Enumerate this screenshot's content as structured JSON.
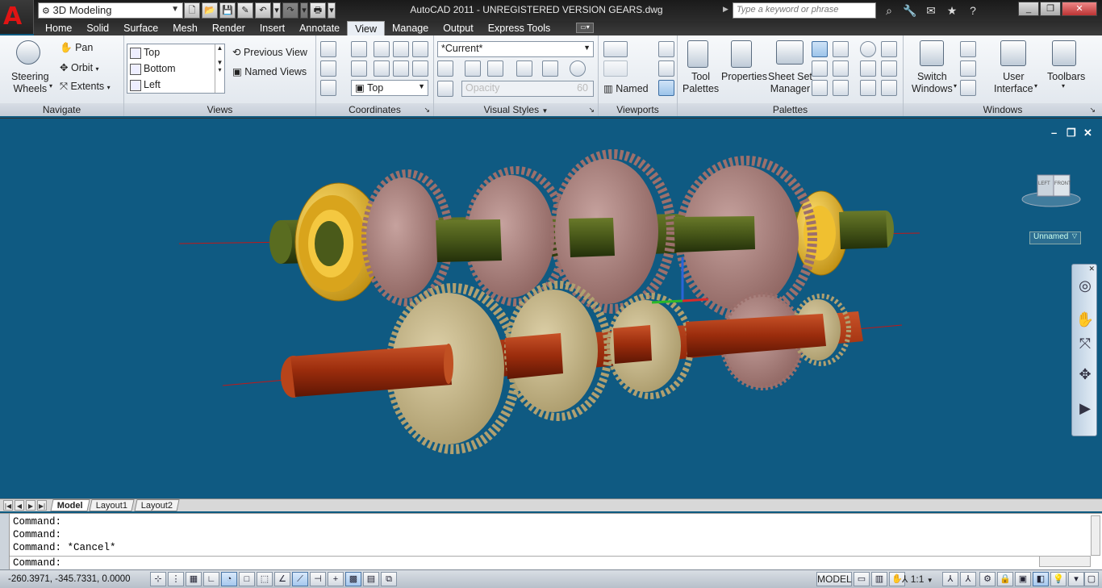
{
  "title_bar": {
    "workspace": "3D Modeling",
    "title": "AutoCAD 2011 - UNREGISTERED VERSION    GEARS.dwg",
    "search_placeholder": "Type a keyword or phrase"
  },
  "ribbon_tabs": [
    "Home",
    "Solid",
    "Surface",
    "Mesh",
    "Render",
    "Insert",
    "Annotate",
    "View",
    "Manage",
    "Output",
    "Express Tools"
  ],
  "active_tab": "View",
  "navigate": {
    "title": "Navigate",
    "steering_wheels": "Steering\nWheels",
    "pan": "Pan",
    "orbit": "Orbit",
    "extents": "Extents"
  },
  "views": {
    "title": "Views",
    "list": [
      "Top",
      "Bottom",
      "Left"
    ],
    "previous_view": "Previous View",
    "named_views": "Named Views"
  },
  "coordinates": {
    "title": "Coordinates",
    "ucs_combo": "Top"
  },
  "visual_styles": {
    "title": "Visual Styles",
    "current": "*Current*",
    "opacity_label": "Opacity",
    "opacity_value": "60"
  },
  "viewports": {
    "title": "Viewports",
    "named": "Named"
  },
  "palettes": {
    "title": "Palettes",
    "tool_palettes": "Tool\nPalettes",
    "properties": "Properties",
    "sheet_set_manager": "Sheet Set\nManager"
  },
  "windows": {
    "title": "Windows",
    "switch_windows": "Switch\nWindows",
    "user_interface": "User\nInterface",
    "toolbars": "Toolbars"
  },
  "viewport": {
    "view_name": "Unnamed",
    "viewcube_left": "LEFT",
    "viewcube_front": "FRONT"
  },
  "layout_tabs": [
    "Model",
    "Layout1",
    "Layout2"
  ],
  "active_layout": "Model",
  "command_history": [
    "Command:",
    "Command:",
    "Command: *Cancel*"
  ],
  "command_prompt": "Command:",
  "status_bar": {
    "coordinates": "-260.3971, -345.7331, 0.0000",
    "model": "MODEL",
    "scale": "1:1"
  },
  "colors": {
    "viewport_bg": "#0f5a82",
    "gear_pink": "#b58a86",
    "gear_tan": "#c8b888",
    "shaft_olive": "#4a5a1a",
    "shaft_red": "#a03010",
    "bearing_gold": "#e0b020"
  }
}
